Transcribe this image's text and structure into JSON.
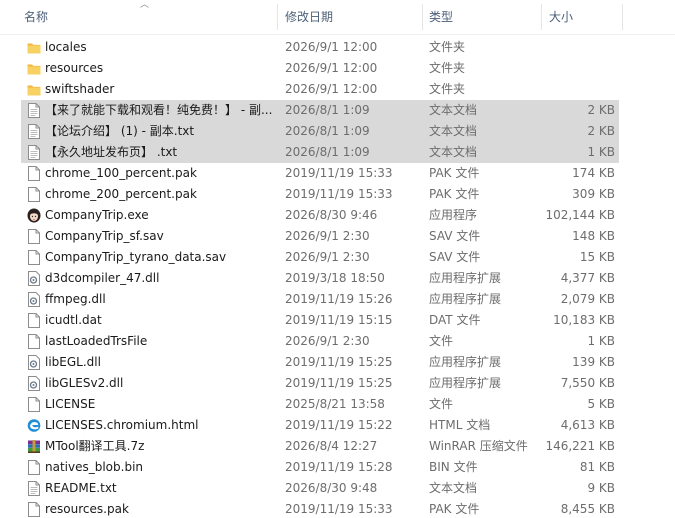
{
  "columns": {
    "name": "名称",
    "date": "修改日期",
    "type": "类型",
    "size": "大小"
  },
  "files": [
    {
      "name": "locales",
      "date": "2026/9/1 12:00",
      "type": "文件夹",
      "size": "",
      "icon": "folder-icon",
      "selected": false
    },
    {
      "name": "resources",
      "date": "2026/9/1 12:00",
      "type": "文件夹",
      "size": "",
      "icon": "folder-icon",
      "selected": false
    },
    {
      "name": "swiftshader",
      "date": "2026/9/1 12:00",
      "type": "文件夹",
      "size": "",
      "icon": "folder-icon",
      "selected": false
    },
    {
      "name": "【来了就能下载和观看！纯免费！】 - 副...",
      "date": "2026/8/1 1:09",
      "type": "文本文档",
      "size": "2 KB",
      "icon": "text-file-icon",
      "selected": true
    },
    {
      "name": "【论坛介绍】 (1) - 副本.txt",
      "date": "2026/8/1 1:09",
      "type": "文本文档",
      "size": "2 KB",
      "icon": "text-file-icon",
      "selected": true
    },
    {
      "name": "【永久地址发布页】 .txt",
      "date": "2026/8/1 1:09",
      "type": "文本文档",
      "size": "1 KB",
      "icon": "text-file-icon",
      "selected": true
    },
    {
      "name": "chrome_100_percent.pak",
      "date": "2019/11/19 15:33",
      "type": "PAK 文件",
      "size": "174 KB",
      "icon": "file-icon",
      "selected": false
    },
    {
      "name": "chrome_200_percent.pak",
      "date": "2019/11/19 15:33",
      "type": "PAK 文件",
      "size": "309 KB",
      "icon": "file-icon",
      "selected": false
    },
    {
      "name": "CompanyTrip.exe",
      "date": "2026/8/30 9:46",
      "type": "应用程序",
      "size": "102,144 KB",
      "icon": "app-character-icon",
      "selected": false
    },
    {
      "name": "CompanyTrip_sf.sav",
      "date": "2026/9/1 2:30",
      "type": "SAV 文件",
      "size": "148 KB",
      "icon": "file-icon",
      "selected": false
    },
    {
      "name": "CompanyTrip_tyrano_data.sav",
      "date": "2026/9/1 2:30",
      "type": "SAV 文件",
      "size": "15 KB",
      "icon": "file-icon",
      "selected": false
    },
    {
      "name": "d3dcompiler_47.dll",
      "date": "2019/3/18 18:50",
      "type": "应用程序扩展",
      "size": "4,377 KB",
      "icon": "dll-gear-icon",
      "selected": false
    },
    {
      "name": "ffmpeg.dll",
      "date": "2019/11/19 15:26",
      "type": "应用程序扩展",
      "size": "2,079 KB",
      "icon": "dll-gear-icon",
      "selected": false
    },
    {
      "name": "icudtl.dat",
      "date": "2019/11/19 15:15",
      "type": "DAT 文件",
      "size": "10,183 KB",
      "icon": "file-icon",
      "selected": false
    },
    {
      "name": "lastLoadedTrsFile",
      "date": "2026/9/1 2:30",
      "type": "文件",
      "size": "1 KB",
      "icon": "file-icon",
      "selected": false
    },
    {
      "name": "libEGL.dll",
      "date": "2019/11/19 15:25",
      "type": "应用程序扩展",
      "size": "139 KB",
      "icon": "dll-gear-icon",
      "selected": false
    },
    {
      "name": "libGLESv2.dll",
      "date": "2019/11/19 15:25",
      "type": "应用程序扩展",
      "size": "7,550 KB",
      "icon": "dll-gear-icon",
      "selected": false
    },
    {
      "name": "LICENSE",
      "date": "2025/8/21 13:58",
      "type": "文件",
      "size": "5 KB",
      "icon": "file-icon",
      "selected": false
    },
    {
      "name": "LICENSES.chromium.html",
      "date": "2019/11/19 15:22",
      "type": "HTML 文档",
      "size": "4,613 KB",
      "icon": "edge-html-icon",
      "selected": false
    },
    {
      "name": "MTool翻译工具.7z",
      "date": "2026/8/4 12:27",
      "type": "WinRAR 压缩文件",
      "size": "146,221 KB",
      "icon": "winrar-archive-icon",
      "selected": false
    },
    {
      "name": "natives_blob.bin",
      "date": "2019/11/19 15:28",
      "type": "BIN 文件",
      "size": "81 KB",
      "icon": "file-icon",
      "selected": false
    },
    {
      "name": "README.txt",
      "date": "2026/8/30 9:48",
      "type": "文本文档",
      "size": "9 KB",
      "icon": "text-file-icon",
      "selected": false
    },
    {
      "name": "resources.pak",
      "date": "2019/11/19 15:33",
      "type": "PAK 文件",
      "size": "8,455 KB",
      "icon": "file-icon",
      "selected": false
    }
  ],
  "colors": {
    "selection": "#d9d9d9",
    "header_text": "#4c607a",
    "folder": "#f7c948"
  }
}
